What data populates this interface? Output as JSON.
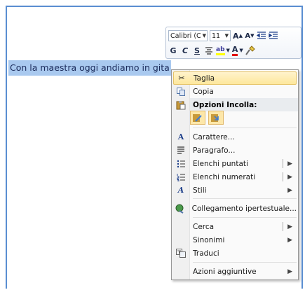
{
  "document": {
    "selected_text": "Con la maestra oggi andiamo in gita"
  },
  "mini_toolbar": {
    "font_name": "Calibri (C",
    "font_size": "11",
    "grow_font": "A",
    "shrink_font": "A",
    "bold": "G",
    "italic": "C",
    "underline": "S",
    "font_color": "A"
  },
  "context_menu": {
    "items": [
      {
        "label": "Taglia",
        "icon": "scissors-icon"
      },
      {
        "label": "Copia",
        "icon": "copy-icon"
      },
      {
        "label": "Opzioni Incolla:",
        "icon": "paste-icon"
      },
      {
        "label": "Carattere...",
        "icon": "font-icon"
      },
      {
        "label": "Paragrafo...",
        "icon": "paragraph-icon"
      },
      {
        "label": "Elenchi puntati",
        "icon": "bullets-icon"
      },
      {
        "label": "Elenchi numerati",
        "icon": "numbering-icon"
      },
      {
        "label": "Stili",
        "icon": "styles-icon"
      },
      {
        "label": "Collegamento ipertestuale...",
        "icon": "hyperlink-icon"
      },
      {
        "label": "Cerca",
        "icon": ""
      },
      {
        "label": "Sinonimi",
        "icon": ""
      },
      {
        "label": "Traduci",
        "icon": "translate-icon"
      },
      {
        "label": "Azioni aggiuntive",
        "icon": ""
      }
    ]
  },
  "colors": {
    "selection": "#a9c9ef",
    "highlight": "#fde79c",
    "border_accent": "#5a8ed1"
  }
}
